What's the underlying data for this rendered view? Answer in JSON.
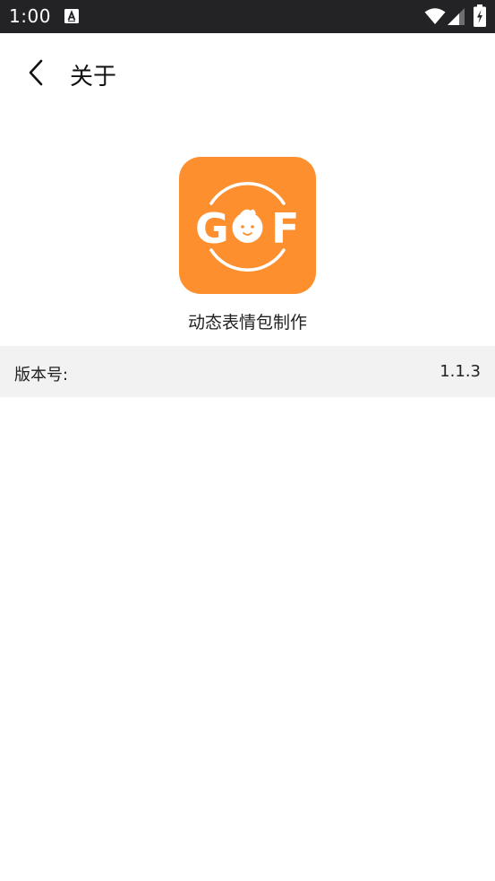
{
  "status_bar": {
    "time": "1:00",
    "notification_icon": "a-box-icon",
    "icons": [
      "wifi-icon",
      "signal-icon",
      "battery-icon"
    ]
  },
  "header": {
    "back_icon": "chevron-left-icon",
    "title": "关于"
  },
  "app": {
    "icon_name": "gif-logo-icon",
    "icon_text_left": "G",
    "icon_text_right": "F",
    "name": "动态表情包制作",
    "brand_color": "#fd8f2f"
  },
  "info": {
    "version_label": "版本号:",
    "version_value": "1.1.3"
  }
}
